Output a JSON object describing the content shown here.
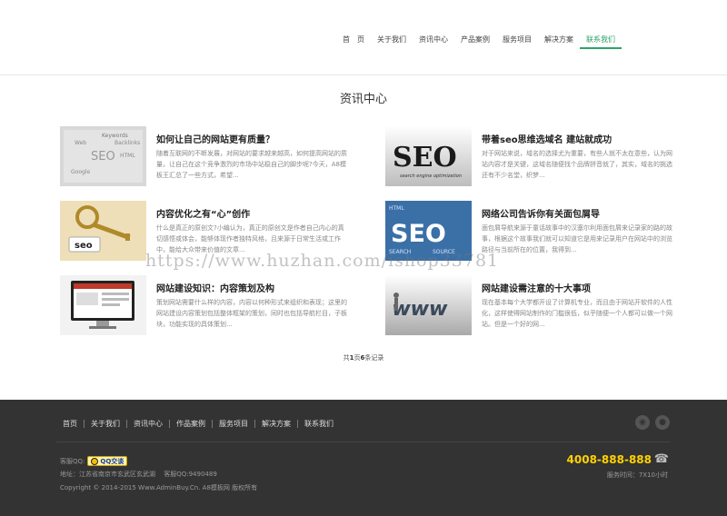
{
  "nav": {
    "items": [
      {
        "label": "首　页"
      },
      {
        "label": "关于我们"
      },
      {
        "label": "资讯中心"
      },
      {
        "label": "产品案例"
      },
      {
        "label": "服务项目"
      },
      {
        "label": "解决方案"
      },
      {
        "label": "联系我们"
      }
    ],
    "active_index": 6,
    "accent_color": "#2fa36b"
  },
  "page_title": "资讯中心",
  "news": [
    {
      "title": "如何让自己的网站更有质量？",
      "desc": "随着互联网的不断发展，对网站的要求越来越高，如何提高网站的质量，让自己在这个竞争激烈的市场中站稳自己的脚步呢?今天，A8模板王汇总了一些方式，希望...",
      "thumb": {
        "words": [
          "Keywords",
          "Web",
          "Backlinks",
          "SEO",
          "HTML",
          "Google"
        ]
      }
    },
    {
      "title": "带着seo思维选域名 建站就成功",
      "desc": "对于网站来说，域名的选择尤为重要，有些人就不太在意些，认为网站内容才是关键，这域名随便找个品牌拼音就了，其实，域名的挑选还有不少名堂，织梦...",
      "thumb": {
        "big": "SEO",
        "small": "search engine optimization"
      }
    },
    {
      "title": "内容优化之有“心”创作",
      "desc": "什么是真正的原创文?小编认为，真正的原创文是作者自己内心的真切感悟或体会，能够体现作者独特风格，且来源于日常生活或工作中，能给大众带来价值的文章...",
      "thumb": {
        "tag": "seo"
      }
    },
    {
      "title": "网络公司告诉你有关面包屑导",
      "desc": "面包屑导航来源于童话故事中的汉塞尔利用面包屑来记录家的路的故事，根据这个故事我们就可以知道它是用来记录用户在网站中的浏览路径与当前所在的位置，我得到...",
      "thumb": {
        "big": "SEO",
        "words": [
          "HTML",
          "SEARCH",
          "SOURCE"
        ]
      }
    },
    {
      "title": "网站建设知识：内容策划及构",
      "desc": "策划网站需要什么样的内容，内容以何种形式来组织和表现；这里的网站建设内容策划包括整体框架的策划，同时也包括导航栏目，子板块，功能实现的具体策划...",
      "thumb": {
        "kind": "monitor"
      }
    },
    {
      "title": "网站建设需注意的十大事项",
      "desc": "现在基本每个大学都开设了计算机专业，而且由于网站开软件的人性化，这样使得网站制作的门槛很低，似乎随便一个人都可以做一个网站。但是一个好的网...",
      "thumb": {
        "word": "www"
      }
    }
  ],
  "pager": {
    "prefix": "共",
    "pages": "1",
    "mid": "页",
    "records": "6",
    "suffix": "条记录"
  },
  "watermark": "https://www.huzhan.com/ishop33781",
  "footer": {
    "nav": [
      "首页",
      "关于我们",
      "资讯中心",
      "作品案例",
      "服务项目",
      "解决方案",
      "联系我们"
    ],
    "icons": [
      "weibo-icon",
      "qq-icon"
    ],
    "qq_label": "客服QQ:",
    "qq_button": "QQ交谈",
    "address": "地址：江苏省南京市玄武区玄武湖　 客服QQ:9490489",
    "copyright": "Copyright © 2014-2015 Www.AdminBuy.Cn. A8模板网 版权所有",
    "phone": "4008-888-888",
    "hours": "服务时间：7X10小时",
    "bg_color": "#333333",
    "phone_color": "#ffd200"
  }
}
